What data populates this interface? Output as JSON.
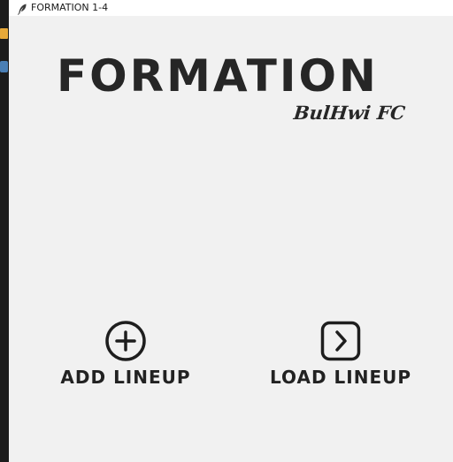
{
  "window": {
    "title": "FORMATION 1-4",
    "title_icon": "feather-icon"
  },
  "logo": {
    "title": "FORMATION",
    "subtitle": "BulHwi FC"
  },
  "actions": [
    {
      "label": "ADD LINEUP",
      "icon": "plus-circle-icon"
    },
    {
      "label": "LOAD LINEUP",
      "icon": "chevron-right-square-icon"
    }
  ],
  "colors": {
    "background": "#f1f1f1",
    "text": "#262626",
    "titlebar": "#ffffff"
  }
}
